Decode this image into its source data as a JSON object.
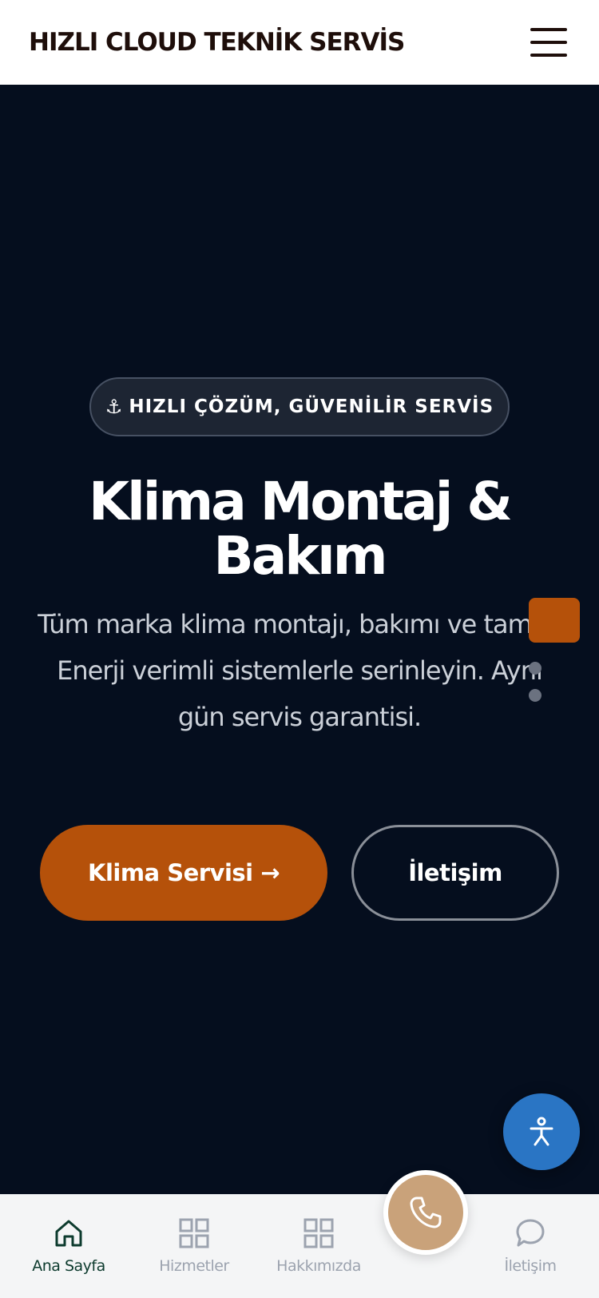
{
  "header": {
    "brand": "HIZLI CLOUD TEKNİK SERVİS",
    "menu_icon": "hamburger-menu-icon"
  },
  "hero": {
    "badge_icon": "anchor-icon",
    "badge_icon_glyph": "⚓",
    "badge_text": "HIZLI ÇÖZÜM, GÜVENİLİR SERVİS",
    "title": "Klima Montaj & Bakım",
    "description": "Tüm marka klima montajı, bakımı ve tamiri. Enerji verimli sistemlerle serinleyin. Aynı gün servis garantisi.",
    "primary_button": "Klima Servisi →",
    "secondary_button": "İletişim"
  },
  "bottom_nav": {
    "items": [
      {
        "label": "Ana Sayfa",
        "icon": "home-icon",
        "active": true
      },
      {
        "label": "Hizmetler",
        "icon": "grid-icon",
        "active": false
      },
      {
        "label": "Hakkımızda",
        "icon": "grid-icon",
        "active": false
      },
      {
        "label": "İletişim",
        "icon": "chat-bubble-icon",
        "active": false
      }
    ],
    "call_icon": "phone-icon"
  },
  "floating": {
    "accessibility_icon": "accessibility-person-icon"
  },
  "colors": {
    "accent": "#b5510a",
    "hero_background": "#050e1e",
    "call_button": "#c9a27a",
    "accessibility_button": "#2a75c4",
    "active_nav": "#0d3b2e"
  }
}
